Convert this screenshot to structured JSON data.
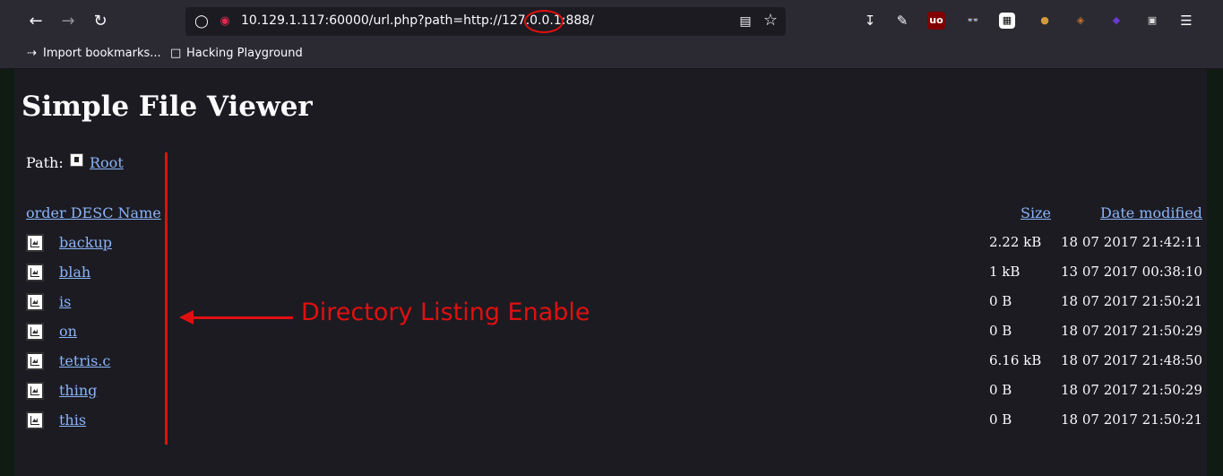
{
  "browser": {
    "url": "10.129.1.117:60000/url.php?path=http://127.0.0.1:888/",
    "bookmarks": [
      {
        "label": "Import bookmarks...",
        "icon": "import-icon"
      },
      {
        "label": "Hacking Playground",
        "icon": "folder-icon"
      }
    ],
    "extensions": [
      "ublock-icon",
      "glasses-icon",
      "qr-icon",
      "cookie-icon",
      "noodle-icon",
      "gem-icon",
      "cube-icon"
    ]
  },
  "page": {
    "title": "Simple File Viewer",
    "path_label": "Path:",
    "path_root": "Root",
    "columns": {
      "name": "order DESC Name",
      "size": "Size",
      "date": "Date modified"
    },
    "files": [
      {
        "name": "backup",
        "size": "2.22 kB",
        "date": "18 07 2017 21:42:11"
      },
      {
        "name": "blah",
        "size": "1 kB",
        "date": "13 07 2017 00:38:10"
      },
      {
        "name": "is",
        "size": "0 B",
        "date": "18 07 2017 21:50:21"
      },
      {
        "name": "on",
        "size": "0 B",
        "date": "18 07 2017 21:50:29"
      },
      {
        "name": "tetris.c",
        "size": "6.16 kB",
        "date": "18 07 2017 21:48:50"
      },
      {
        "name": "thing",
        "size": "0 B",
        "date": "18 07 2017 21:50:29"
      },
      {
        "name": "this",
        "size": "0 B",
        "date": "18 07 2017 21:50:21"
      }
    ]
  },
  "annotation": {
    "text": "Directory Listing Enable",
    "color": "#e01010"
  }
}
